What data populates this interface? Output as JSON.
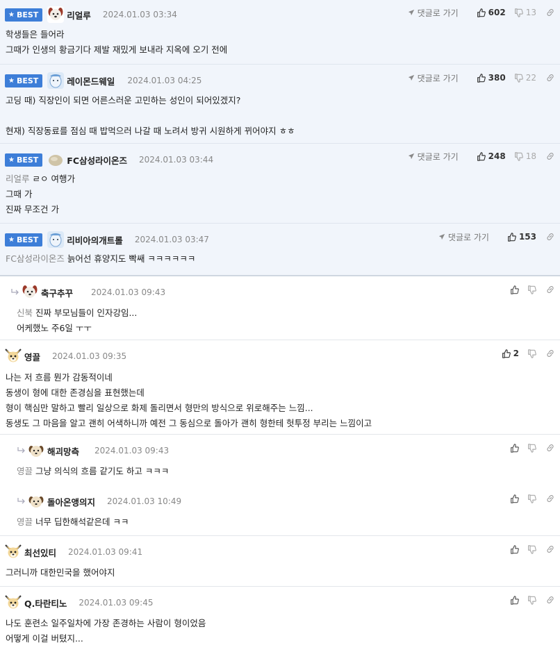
{
  "labels": {
    "best": "BEST",
    "reply_link": "댓글로 가기"
  },
  "comments": [
    {
      "nick": "리얼루",
      "date": "2024.01.03 03:34",
      "up": "602",
      "down": "13",
      "lines": [
        "학생들은 들어라",
        "그때가 인생의 황금기다 제발 재밌게 보내라 지옥에 오기 전에"
      ]
    },
    {
      "nick": "레이몬드웨일",
      "date": "2024.01.03 04:25",
      "up": "380",
      "down": "22",
      "lines": [
        "고딩 때) 직장인이 되면 어른스러운 고민하는 성인이 되어있겠지?",
        "",
        "현재) 직장동료를 점심 때 밥먹으러 나갈 때 노려서 방귀 시원하게 뀌어야지 ㅎㅎ"
      ]
    },
    {
      "nick": "FC삼성라이온즈",
      "date": "2024.01.03 03:44",
      "up": "248",
      "down": "18",
      "mention": "리얼루",
      "lines": [
        "ㄹㅇ 여행가",
        "그때 가",
        "진짜 무조건 가"
      ]
    },
    {
      "nick": "리비아의개트롤",
      "date": "2024.01.03 03:47",
      "up": "153",
      "mention": "FC삼성라이온즈",
      "lines": [
        "늙어선 휴양지도 빡쌔 ㅋㅋㅋㅋㅋㅋ"
      ]
    },
    {
      "nick": "축구추꾸",
      "date": "2024.01.03 09:43",
      "mention": "신북",
      "lines": [
        "진짜 부모님들이 인자강임...",
        "어케했노 주6일 ㅜㅜ"
      ]
    },
    {
      "nick": "영끌",
      "date": "2024.01.03 09:35",
      "up": "2",
      "lines": [
        "나는 저 흐름 뭔가 감동적이네",
        "동생이 형에 대한 존경심을 표현했는데",
        "형이 핵심만 말하고 빨리 일상으로 화제 돌리면서 형만의 방식으로 위로해주는 느낌...",
        "동생도 그 마음을 알고 괜히 어색하니까 예전 그 동심으로 돌아가 괜히 형한테 헛투정 부리는 느낌이고"
      ]
    },
    {
      "nick": "해괴망측",
      "date": "2024.01.03 09:43",
      "mention": "영끌",
      "lines": [
        "그냥 의식의 흐름 같기도 하고 ㅋㅋㅋ"
      ]
    },
    {
      "nick": "돌아온앵의지",
      "date": "2024.01.03 10:49",
      "mention": "영끌",
      "lines": [
        "너무 딥한해석같은데 ㅋㅋ"
      ]
    },
    {
      "nick": "최선있티",
      "date": "2024.01.03 09:41",
      "lines": [
        "그러니까 대한민국을 했어야지"
      ]
    },
    {
      "nick": "Q.타란티노",
      "date": "2024.01.03 09:45",
      "lines": [
        "나도 훈련소 일주일차에 가장 존경하는 사람이 형이었음",
        "어떻게 이걸 버텼지..."
      ]
    }
  ]
}
